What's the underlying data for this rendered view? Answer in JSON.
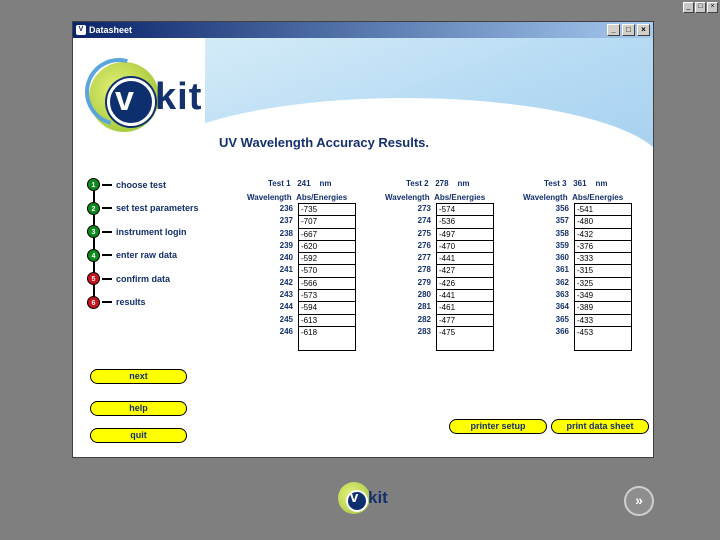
{
  "window": {
    "title": "Datasheet",
    "app_icon": "V",
    "controls": [
      "_",
      "□",
      "×"
    ]
  },
  "logo": {
    "v": "v",
    "kit": "kit"
  },
  "page_title": "UV Wavelength Accuracy Results.",
  "steps": [
    {
      "num": "1",
      "label": "choose test",
      "status": "green"
    },
    {
      "num": "2",
      "label": "set test parameters",
      "status": "green"
    },
    {
      "num": "3",
      "label": "instrument login",
      "status": "green"
    },
    {
      "num": "4",
      "label": "enter raw data",
      "status": "green"
    },
    {
      "num": "5",
      "label": "confirm data",
      "status": "red"
    },
    {
      "num": "6",
      "label": "results",
      "status": "red"
    }
  ],
  "buttons": {
    "next": "next",
    "help": "help",
    "quit": "quit",
    "printer_setup": "printer setup",
    "print_data_sheet": "print data sheet"
  },
  "tests": [
    {
      "label": "Test 1",
      "value": "241",
      "unit": "nm",
      "col_wavelength": "Wavelength",
      "col_abs": "Abs/Energies",
      "wavelengths": [
        "236",
        "237",
        "238",
        "239",
        "240",
        "241",
        "242",
        "243",
        "244",
        "245",
        "246"
      ],
      "values": [
        "-735",
        "-707",
        "-667",
        "-620",
        "-592",
        "-570",
        "-566",
        "-573",
        "-594",
        "-613",
        "-618"
      ]
    },
    {
      "label": "Test 2",
      "value": "278",
      "unit": "nm",
      "col_wavelength": "Wavelength",
      "col_abs": "Abs/Energies",
      "wavelengths": [
        "273",
        "274",
        "275",
        "276",
        "277",
        "278",
        "279",
        "280",
        "281",
        "282",
        "283"
      ],
      "values": [
        "-574",
        "-536",
        "-497",
        "-470",
        "-441",
        "-427",
        "-426",
        "-441",
        "-461",
        "-477",
        "-475"
      ]
    },
    {
      "label": "Test 3",
      "value": "361",
      "unit": "nm",
      "col_wavelength": "Wavelength",
      "col_abs": "Abs/Energies",
      "wavelengths": [
        "356",
        "357",
        "358",
        "359",
        "360",
        "361",
        "362",
        "363",
        "364",
        "365",
        "366"
      ],
      "values": [
        "-541",
        "-480",
        "-432",
        "-376",
        "-333",
        "-315",
        "-325",
        "-349",
        "-389",
        "-433",
        "-453"
      ]
    }
  ],
  "bottom_logo": {
    "v": "v",
    "kit": "kit"
  },
  "forward_icon": "»"
}
